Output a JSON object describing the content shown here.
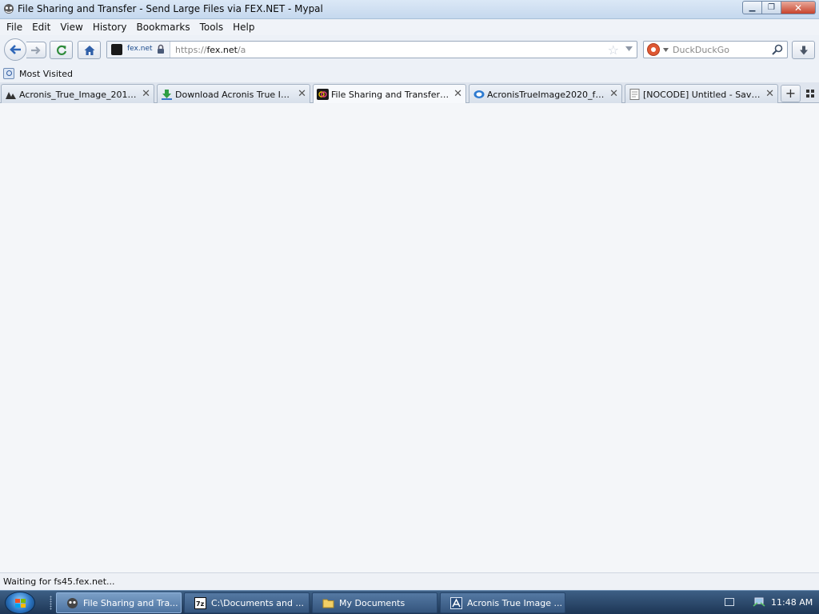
{
  "window": {
    "title": "File Sharing and Transfer - Send Large Files via FEX.NET - Mypal",
    "minimize": "▁",
    "maximize": "❐",
    "close": "✕"
  },
  "menu": [
    "File",
    "Edit",
    "View",
    "History",
    "Bookmarks",
    "Tools",
    "Help"
  ],
  "urlbar": {
    "site_identity": "fex.net",
    "scheme": "https://",
    "host": "fex.net",
    "path": "/a"
  },
  "search": {
    "placeholder": "DuckDuckGo",
    "engine_icon": "duckduckgo-icon"
  },
  "bookmarks": {
    "most_visited": "Most Visited"
  },
  "tabs": [
    {
      "label": "Acronis_True_Image_2015_v...",
      "icon": "softpedia-icon",
      "active": false
    },
    {
      "label": "Download Acronis True Ima...",
      "icon": "download-icon",
      "active": false
    },
    {
      "label": "File Sharing and Transfer - ...",
      "icon": "fex-icon",
      "active": true
    },
    {
      "label": "AcronisTrueImage2020_full_...",
      "icon": "cloud-icon",
      "active": false
    },
    {
      "label": "[NOCODE] Untitled - SaveTe...",
      "icon": "page-icon",
      "active": false
    }
  ],
  "tab_close": "✕",
  "newtab": "+",
  "status": {
    "text": "Waiting for fs45.fex.net..."
  },
  "taskbar": {
    "items": [
      {
        "label": "File Sharing and Tra...",
        "active": true
      },
      {
        "label": "C:\\Documents and ...",
        "active": false
      },
      {
        "label": "My Documents",
        "active": false
      },
      {
        "label": "Acronis True Image ...",
        "active": false
      }
    ],
    "clock": "11:48 AM"
  }
}
